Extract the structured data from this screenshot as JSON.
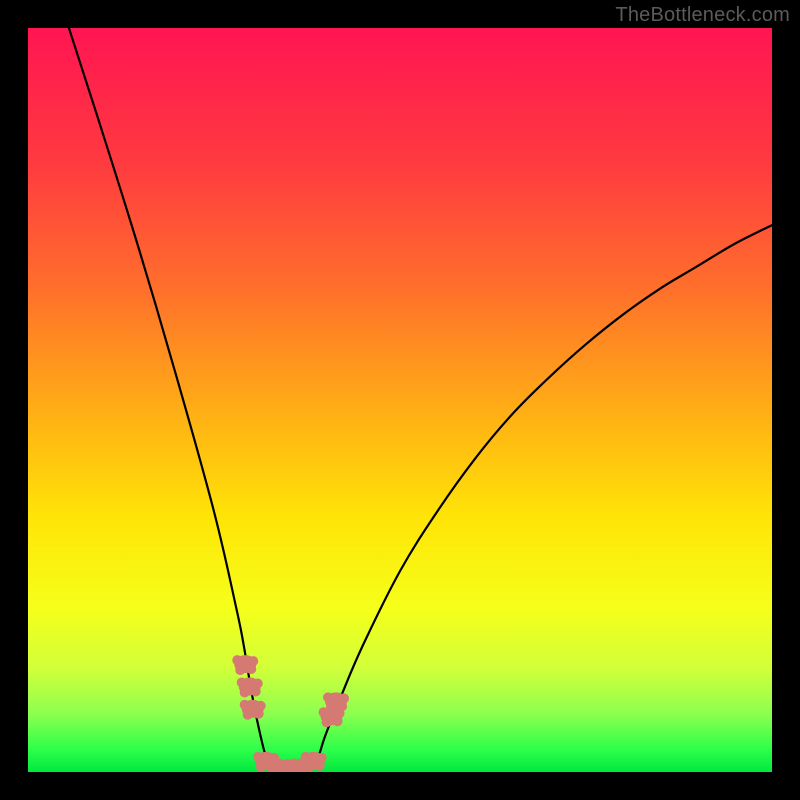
{
  "watermark": "TheBottleneck.com",
  "chart_data": {
    "type": "line",
    "title": "",
    "xlabel": "",
    "ylabel": "",
    "xlim": [
      0,
      100
    ],
    "ylim": [
      0,
      100
    ],
    "grid": false,
    "legend": false,
    "annotations": [],
    "curve_left": {
      "description": "Descending curve from top-left toward trough near x≈33",
      "points": [
        {
          "x": 5.5,
          "y": 100
        },
        {
          "x": 10,
          "y": 86
        },
        {
          "x": 15,
          "y": 70
        },
        {
          "x": 20,
          "y": 53
        },
        {
          "x": 25,
          "y": 35
        },
        {
          "x": 28,
          "y": 22
        },
        {
          "x": 29,
          "y": 17
        },
        {
          "x": 30,
          "y": 11
        },
        {
          "x": 31,
          "y": 6
        },
        {
          "x": 32,
          "y": 2
        },
        {
          "x": 33,
          "y": 0.2
        }
      ]
    },
    "curve_right": {
      "description": "Ascending curve from trough near x≈38 toward upper right",
      "points": [
        {
          "x": 38,
          "y": 0.2
        },
        {
          "x": 39,
          "y": 2
        },
        {
          "x": 40,
          "y": 5
        },
        {
          "x": 42,
          "y": 10
        },
        {
          "x": 45,
          "y": 17
        },
        {
          "x": 50,
          "y": 27
        },
        {
          "x": 55,
          "y": 35
        },
        {
          "x": 60,
          "y": 42
        },
        {
          "x": 65,
          "y": 48
        },
        {
          "x": 70,
          "y": 53
        },
        {
          "x": 75,
          "y": 57.5
        },
        {
          "x": 80,
          "y": 61.5
        },
        {
          "x": 85,
          "y": 65
        },
        {
          "x": 90,
          "y": 68
        },
        {
          "x": 95,
          "y": 71
        },
        {
          "x": 100,
          "y": 73.5
        }
      ]
    },
    "markers": {
      "description": "Salmon/coral lobed marker clusters near the trough",
      "color": "#d57a73",
      "clusters": [
        {
          "x": 29.2,
          "y": 14.5
        },
        {
          "x": 29.8,
          "y": 11.5
        },
        {
          "x": 30.2,
          "y": 8.5
        },
        {
          "x": 32.0,
          "y": 1.5
        },
        {
          "x": 33.5,
          "y": 0.6
        },
        {
          "x": 35.0,
          "y": 0.5
        },
        {
          "x": 36.8,
          "y": 0.6
        },
        {
          "x": 38.4,
          "y": 1.5
        },
        {
          "x": 40.8,
          "y": 7.5
        },
        {
          "x": 41.4,
          "y": 9.5
        }
      ]
    },
    "background_gradient": {
      "description": "Vertical rainbow-ish gradient, magenta-red at top through orange, yellow to saturated green at bottom",
      "stops": [
        {
          "offset": 0,
          "color": "#ff1552"
        },
        {
          "offset": 18,
          "color": "#ff3a40"
        },
        {
          "offset": 35,
          "color": "#ff6f2b"
        },
        {
          "offset": 52,
          "color": "#ffb014"
        },
        {
          "offset": 66,
          "color": "#ffe507"
        },
        {
          "offset": 78,
          "color": "#f5ff1a"
        },
        {
          "offset": 86,
          "color": "#d2ff39"
        },
        {
          "offset": 92,
          "color": "#8fff4f"
        },
        {
          "offset": 97,
          "color": "#2dff4a"
        },
        {
          "offset": 100,
          "color": "#00e83e"
        }
      ]
    }
  }
}
